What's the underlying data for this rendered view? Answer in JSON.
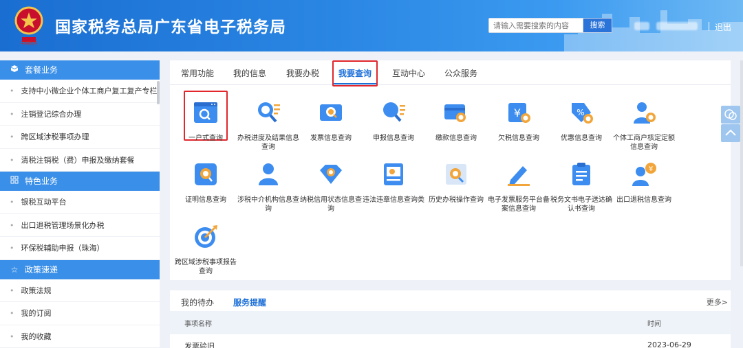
{
  "header": {
    "title": "国家税务总局广东省电子税务局",
    "search_placeholder": "请输入需要搜索的内容",
    "search_button": "搜索",
    "logout": "退出",
    "brand_color": "#2a86e3"
  },
  "sidebar": {
    "sections": [
      {
        "title": "套餐业务",
        "icon": "cube-icon",
        "items": [
          "支持中小微企业个体工商户复工复产专栏",
          "注销登记综合办理",
          "跨区域涉税事项办理",
          "清税注销税（费）申报及缴纳套餐"
        ]
      },
      {
        "title": "特色业务",
        "icon": "grid-icon",
        "items": [
          "银税互动平台",
          "出口退税管理场景化办税",
          "环保税辅助申报（珠海）"
        ]
      },
      {
        "title": "政策速递",
        "icon": "star-icon",
        "items": [
          "政策法规",
          "我的订阅",
          "我的收藏"
        ]
      }
    ]
  },
  "main": {
    "tabs": [
      "常用功能",
      "我的信息",
      "我要办税",
      "我要查询",
      "互动中心",
      "公众服务"
    ],
    "active_tab": "我要查询",
    "items": [
      {
        "label": "一户式查询",
        "icon": "browser-search-icon"
      },
      {
        "label": "办税进度及结果信息查询",
        "icon": "magnifier-list-icon"
      },
      {
        "label": "发票信息查询",
        "icon": "invoice-search-icon"
      },
      {
        "label": "申报信息查询",
        "icon": "declaration-search-icon"
      },
      {
        "label": "缴款信息查询",
        "icon": "card-search-icon"
      },
      {
        "label": "欠税信息查询",
        "icon": "yen-ticket-icon"
      },
      {
        "label": "优惠信息查询",
        "icon": "discount-tag-icon"
      },
      {
        "label": "个体工商户核定定额信息查询",
        "icon": "person-search-icon"
      },
      {
        "label": "证明信息查询",
        "icon": "certificate-search-icon"
      },
      {
        "label": "涉税中介机构信息查询",
        "icon": "agent-person-icon"
      },
      {
        "label": "纳税信用状态信息查询",
        "icon": "diamond-credit-icon"
      },
      {
        "label": "违法违章信息查询类",
        "icon": "violation-doc-icon"
      },
      {
        "label": "历史办税操作查询",
        "icon": "history-search-icon"
      },
      {
        "label": "电子发票服务平台备案信息查询",
        "icon": "pen-edit-icon"
      },
      {
        "label": "税务文书电子送达确认书查询",
        "icon": "clipboard-icon"
      },
      {
        "label": "出口退税信息查询",
        "icon": "person-yen-icon"
      },
      {
        "label": "跨区域涉税事项报告查询",
        "icon": "target-icon"
      }
    ]
  },
  "tasks": {
    "tabs": [
      "我的待办",
      "服务提醒"
    ],
    "active_tab": "服务提醒",
    "more": "更多>",
    "columns": [
      "事项名称",
      "时间"
    ],
    "rows": [
      {
        "name": "发票验旧",
        "time": "2023-06-29"
      }
    ]
  }
}
